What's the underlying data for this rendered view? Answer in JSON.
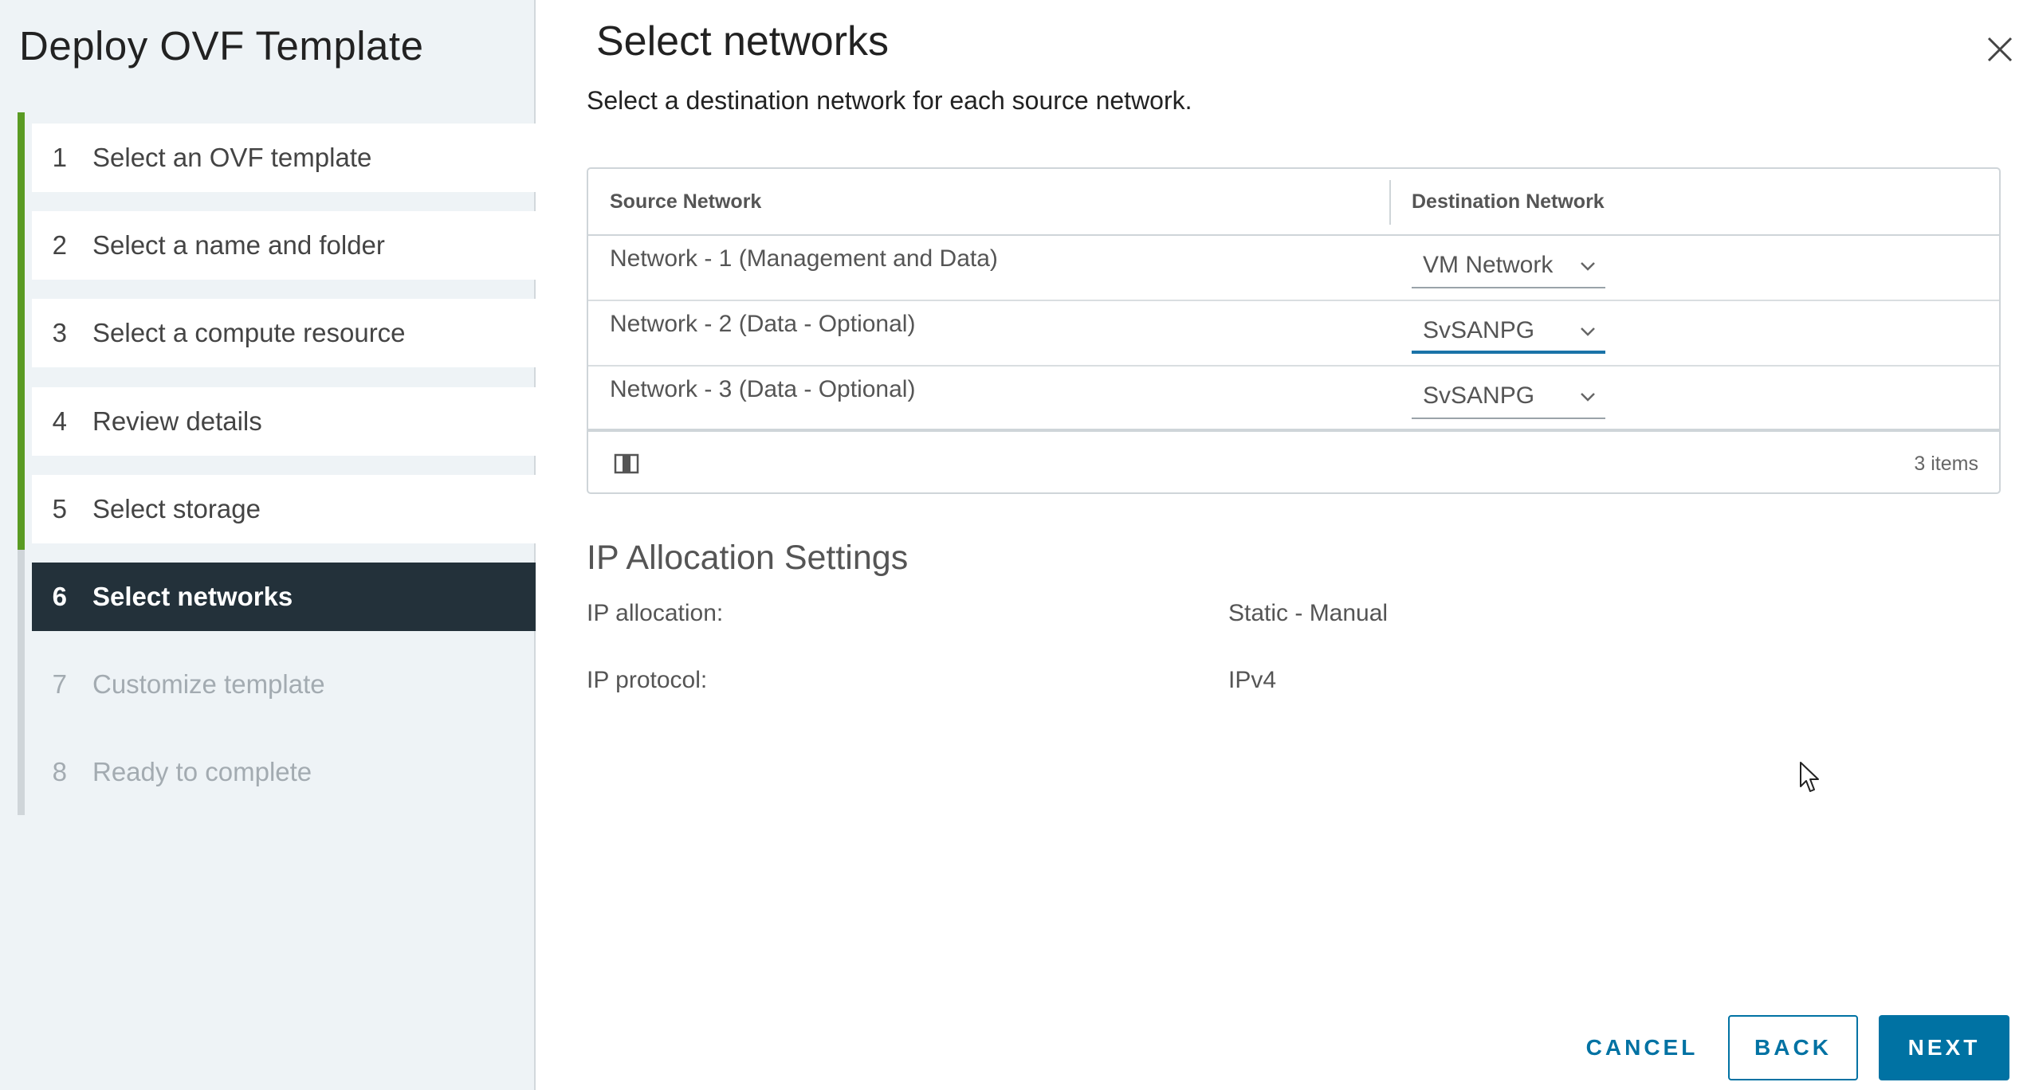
{
  "wizard": {
    "title": "Deploy OVF Template"
  },
  "steps": [
    {
      "num": "1",
      "label": "Select an OVF template"
    },
    {
      "num": "2",
      "label": "Select a name and folder"
    },
    {
      "num": "3",
      "label": "Select a compute resource"
    },
    {
      "num": "4",
      "label": "Review details"
    },
    {
      "num": "5",
      "label": "Select storage"
    },
    {
      "num": "6",
      "label": "Select networks"
    },
    {
      "num": "7",
      "label": "Customize template"
    },
    {
      "num": "8",
      "label": "Ready to complete"
    }
  ],
  "current_step": "6",
  "page": {
    "title": "Select networks",
    "description": "Select a destination network for each source network."
  },
  "grid": {
    "columns": {
      "source": "Source Network",
      "destination": "Destination Network"
    },
    "rows": [
      {
        "source": "Network - 1 (Management and Data)",
        "destination": "VM Network"
      },
      {
        "source": "Network - 2 (Data - Optional)",
        "destination": "SvSANPG"
      },
      {
        "source": "Network - 3 (Data - Optional)",
        "destination": "SvSANPG"
      }
    ],
    "item_count": "3 items"
  },
  "ip_settings": {
    "title": "IP Allocation Settings",
    "allocation_label": "IP allocation:",
    "allocation_value": "Static - Manual",
    "protocol_label": "IP protocol:",
    "protocol_value": "IPv4"
  },
  "buttons": {
    "cancel": "CANCEL",
    "back": "BACK",
    "next": "NEXT"
  },
  "icons": {
    "close": "close-icon",
    "caret": "chevron-down-icon",
    "columns": "column-toggle-icon",
    "cursor": "mouse-pointer-icon"
  },
  "colors": {
    "accent": "#0072a3",
    "progress_done": "#5a9b23",
    "current_step_bg": "#23313a",
    "sidebar_bg": "#eef3f6"
  }
}
